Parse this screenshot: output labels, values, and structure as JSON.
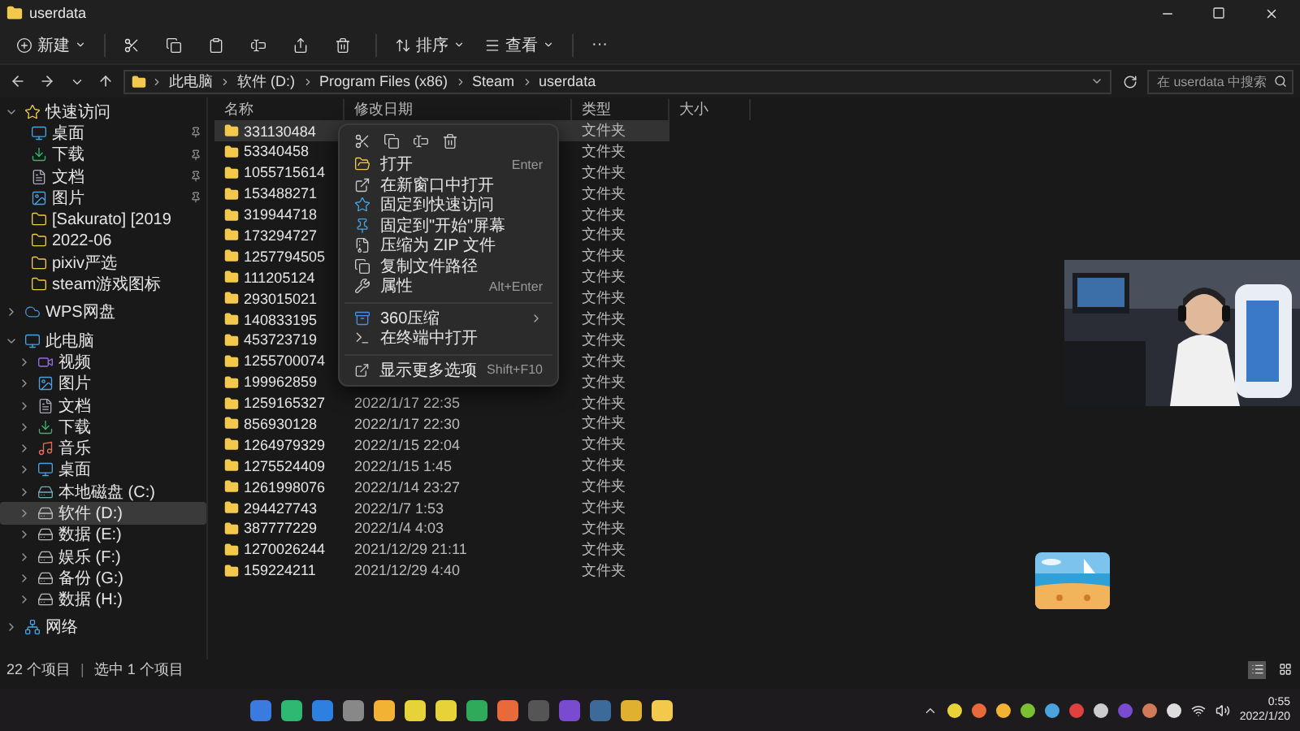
{
  "window": {
    "title": "userdata"
  },
  "toolbar": {
    "new_label": "新建",
    "sort_label": "排序",
    "view_label": "查看",
    "more": "···"
  },
  "address": {
    "crumbs": [
      "此电脑",
      "软件 (D:)",
      "Program Files (x86)",
      "Steam",
      "userdata"
    ]
  },
  "search": {
    "placeholder": "在 userdata 中搜索"
  },
  "sidebar": {
    "items": [
      {
        "label": "快速访问",
        "kind": "star",
        "expanded": true,
        "selected": false,
        "children": [
          {
            "label": "桌面",
            "kind": "desktop",
            "pinned": true,
            "selected": false
          },
          {
            "label": "下载",
            "kind": "download",
            "pinned": true,
            "selected": false
          },
          {
            "label": "文档",
            "kind": "document",
            "pinned": true,
            "selected": false
          },
          {
            "label": "图片",
            "kind": "picture",
            "pinned": true,
            "selected": false
          },
          {
            "label": "[Sakurato] [2019",
            "kind": "folder",
            "pinned": false,
            "selected": false
          },
          {
            "label": "2022-06",
            "kind": "folder",
            "pinned": false,
            "selected": false
          },
          {
            "label": "pixiv严选",
            "kind": "folder",
            "pinned": false,
            "selected": false
          },
          {
            "label": "steam游戏图标",
            "kind": "folder",
            "pinned": false,
            "selected": false
          }
        ]
      },
      {
        "label": "WPS网盘",
        "kind": "cloud",
        "expanded": false,
        "selected": false
      },
      {
        "label": "此电脑",
        "kind": "pc",
        "expanded": true,
        "selected": false,
        "children": [
          {
            "label": "视频",
            "kind": "video",
            "expanded": false,
            "selected": false
          },
          {
            "label": "图片",
            "kind": "picture",
            "expanded": false,
            "selected": false
          },
          {
            "label": "文档",
            "kind": "document",
            "expanded": false,
            "selected": false
          },
          {
            "label": "下载",
            "kind": "download",
            "expanded": false,
            "selected": false
          },
          {
            "label": "音乐",
            "kind": "music",
            "expanded": false,
            "selected": false
          },
          {
            "label": "桌面",
            "kind": "desktop",
            "expanded": false,
            "selected": false
          },
          {
            "label": "本地磁盘 (C:)",
            "kind": "system",
            "expanded": false,
            "selected": false
          },
          {
            "label": "软件 (D:)",
            "kind": "drive",
            "expanded": false,
            "selected": true
          },
          {
            "label": "数据 (E:)",
            "kind": "drive",
            "expanded": false,
            "selected": false
          },
          {
            "label": "娱乐 (F:)",
            "kind": "drive",
            "expanded": false,
            "selected": false
          },
          {
            "label": "备份 (G:)",
            "kind": "drive",
            "expanded": false,
            "selected": false
          },
          {
            "label": "数据 (H:)",
            "kind": "drive",
            "expanded": false,
            "selected": false
          }
        ]
      },
      {
        "label": "网络",
        "kind": "network",
        "expanded": false,
        "selected": false
      }
    ]
  },
  "columns": [
    "名称",
    "修改日期",
    "类型",
    "大小"
  ],
  "rows": [
    {
      "name": "331130484",
      "type": "文件夹",
      "selected": true
    },
    {
      "name": "53340458",
      "type": "文件夹",
      "selected": false
    },
    {
      "name": "1055715614",
      "type": "文件夹",
      "selected": false
    },
    {
      "name": "153488271",
      "type": "文件夹",
      "selected": false
    },
    {
      "name": "319944718",
      "type": "文件夹",
      "selected": false
    },
    {
      "name": "173294727",
      "type": "文件夹",
      "selected": false
    },
    {
      "name": "1257794505",
      "type": "文件夹",
      "selected": false
    },
    {
      "name": "111205124",
      "type": "文件夹",
      "selected": false
    },
    {
      "name": "293015021",
      "type": "文件夹",
      "selected": false
    },
    {
      "name": "140833195",
      "type": "文件夹",
      "selected": false
    },
    {
      "name": "453723719",
      "type": "文件夹",
      "selected": false
    },
    {
      "name": "1255700074",
      "type": "文件夹",
      "selected": false
    },
    {
      "name": "199962859",
      "type": "文件夹",
      "selected": false
    },
    {
      "name": "1259165327",
      "type": "文件夹",
      "date": "2022/1/17 22:35",
      "selected": false
    },
    {
      "name": "856930128",
      "type": "文件夹",
      "date": "2022/1/17 22:30",
      "selected": false
    },
    {
      "name": "1264979329",
      "type": "文件夹",
      "date": "2022/1/15 22:04",
      "selected": false
    },
    {
      "name": "1275524409",
      "type": "文件夹",
      "date": "2022/1/15 1:45",
      "selected": false
    },
    {
      "name": "1261998076",
      "type": "文件夹",
      "date": "2022/1/14 23:27",
      "selected": false
    },
    {
      "name": "294427743",
      "type": "文件夹",
      "date": "2022/1/7 1:53",
      "selected": false
    },
    {
      "name": "387777229",
      "type": "文件夹",
      "date": "2022/1/4 4:03",
      "selected": false
    },
    {
      "name": "1270026244",
      "type": "文件夹",
      "date": "2021/12/29 21:11",
      "selected": false
    },
    {
      "name": "159224211",
      "type": "文件夹",
      "date": "2021/12/29 4:40",
      "selected": false
    }
  ],
  "context_menu": {
    "items": [
      {
        "kind": "item",
        "label": "打开",
        "shortcut": "Enter"
      },
      {
        "kind": "item",
        "label": "在新窗口中打开"
      },
      {
        "kind": "item",
        "label": "固定到快速访问"
      },
      {
        "kind": "item",
        "label": "固定到\"开始\"屏幕"
      },
      {
        "kind": "item",
        "label": "压缩为 ZIP 文件"
      },
      {
        "kind": "item",
        "label": "复制文件路径"
      },
      {
        "kind": "item",
        "label": "属性",
        "shortcut": "Alt+Enter"
      },
      {
        "kind": "separator"
      },
      {
        "kind": "item",
        "label": "360压缩",
        "submenu": true
      },
      {
        "kind": "item",
        "label": "在终端中打开"
      },
      {
        "kind": "separator"
      },
      {
        "kind": "item",
        "label": "显示更多选项",
        "shortcut": "Shift+F10"
      }
    ]
  },
  "status_bar": {
    "count": "22 个项目",
    "divider": "|",
    "selection": "选中 1 个项目",
    "views": [
      {
        "kind": "details",
        "selected": true
      },
      {
        "kind": "tiles",
        "selected": false
      }
    ]
  },
  "taskbar": {
    "time": "0:55",
    "date": "2022/1/20"
  }
}
